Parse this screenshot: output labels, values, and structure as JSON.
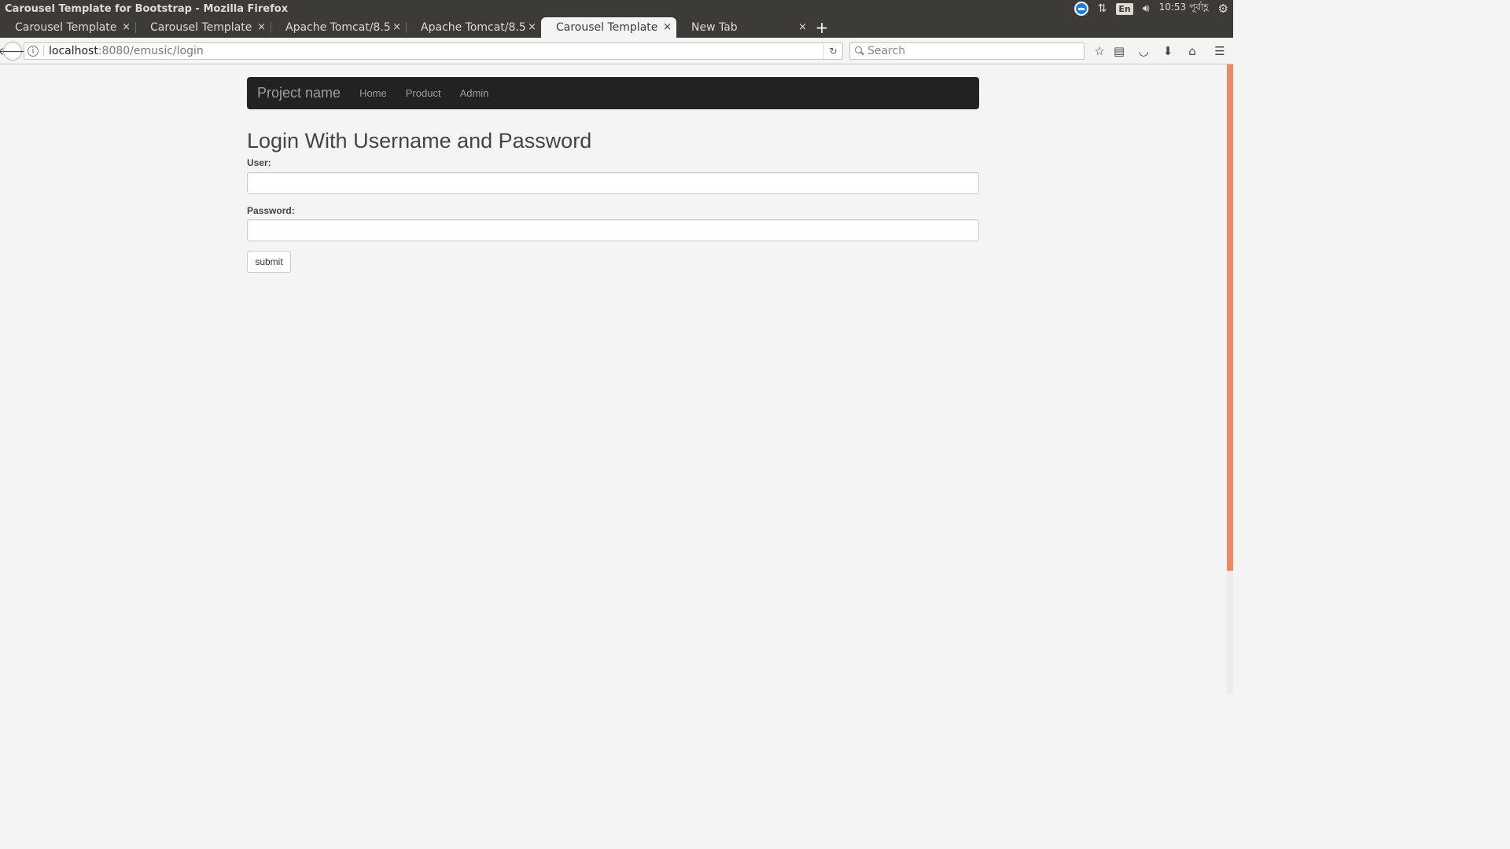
{
  "os_panel": {
    "window_title": "Carousel Template for Bootstrap - Mozilla Firefox",
    "lang": "En",
    "clock": "10:53 পূর্বাহ্ণ"
  },
  "browser": {
    "tabs": [
      {
        "label": "Carousel Template ...",
        "active": false
      },
      {
        "label": "Carousel Template ...",
        "active": false
      },
      {
        "label": "Apache Tomcat/8.5....",
        "active": false
      },
      {
        "label": "Apache Tomcat/8.5....",
        "active": false
      },
      {
        "label": "Carousel Template ...",
        "active": true
      },
      {
        "label": "New Tab",
        "active": false
      }
    ],
    "tab_close_glyph": "×",
    "new_tab_glyph": "+",
    "url_host": "localhost",
    "url_rest": ":8080/emusic/login",
    "search_placeholder": "Search"
  },
  "site": {
    "brand": "Project name",
    "nav_links": [
      "Home",
      "Product",
      "Admin"
    ],
    "heading": "Login With Username and Password",
    "user_label": "User:",
    "password_label": "Password:",
    "submit_label": "submit"
  },
  "colors": {
    "navbar_bg": "#222222",
    "scrollbar_thumb": "#ed8a66",
    "panel_bg": "#3c3b37"
  }
}
